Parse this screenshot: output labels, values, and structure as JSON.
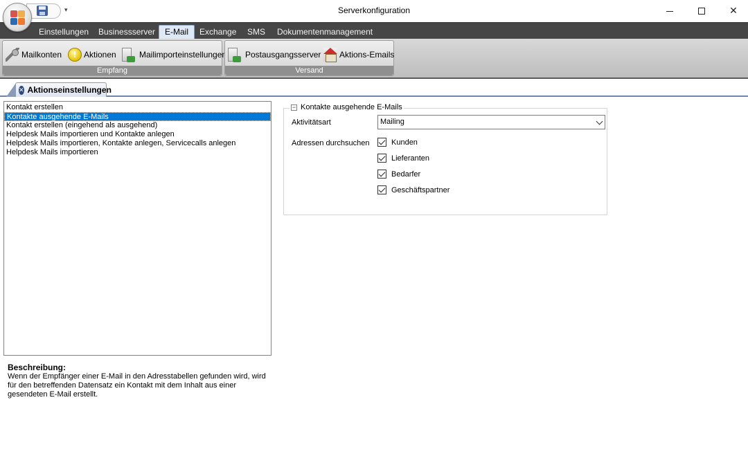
{
  "window": {
    "title": "Serverkonfiguration",
    "qat_dropdown": "▾",
    "close_glyph": "✕"
  },
  "ribbon_tabs": [
    "Einstellungen",
    "Businessserver",
    "E-Mail",
    "Exchange",
    "SMS",
    "Dokumentenmanagement"
  ],
  "active_tab": "E-Mail",
  "ribbon": {
    "groups": [
      {
        "label": "Empfang",
        "buttons": [
          {
            "label": "Mailkonten",
            "icon": "key-icon"
          },
          {
            "label": "Aktionen",
            "icon": "exclamation-icon"
          },
          {
            "label": "Mailimporteinstellungen",
            "icon": "server-import-icon"
          }
        ]
      },
      {
        "label": "Versand",
        "buttons": [
          {
            "label": "Postausgangsserver",
            "icon": "server-export-icon"
          },
          {
            "label": "Aktions-Emails",
            "icon": "house-mail-icon"
          }
        ]
      }
    ]
  },
  "doc_tab": {
    "label": "Aktionseinstellungen",
    "close_glyph": "✕"
  },
  "actions_list": {
    "items": [
      "Kontakt erstellen",
      "Kontakte ausgehende E-Mails",
      "Kontakt erstellen (eingehend als ausgehend)",
      "Helpdesk Mails importieren und Kontakte anlegen",
      "Helpdesk Mails importieren, Kontakte anlegen, Servicecalls anlegen",
      "Helpdesk Mails importieren"
    ],
    "selected_index": 1
  },
  "description": {
    "title": "Beschreibung:",
    "text": "Wenn der Empfänger einer E-Mail in den Adresstabellen gefunden wird, wird für den betreffenden Datensatz ein Kontakt mit dem Inhalt  aus einer gesendeten E-Mail erstellt."
  },
  "settings_group": {
    "title": "Kontakte ausgehende E-Mails",
    "collapse_glyph": "−",
    "activity_label": "Aktivitätsart",
    "activity_value": "Mailing",
    "search_label": "Adressen durchsuchen",
    "checkboxes": [
      {
        "label": "Kunden",
        "checked": true
      },
      {
        "label": "Lieferanten",
        "checked": true
      },
      {
        "label": "Bedarfer",
        "checked": true
      },
      {
        "label": "Geschäftspartner",
        "checked": true
      }
    ]
  },
  "colors": {
    "selection": "#0078d7",
    "tabbar": "#464646",
    "ribbon": "#c8c8c8",
    "doc_tab_border": "#6e84aa"
  }
}
